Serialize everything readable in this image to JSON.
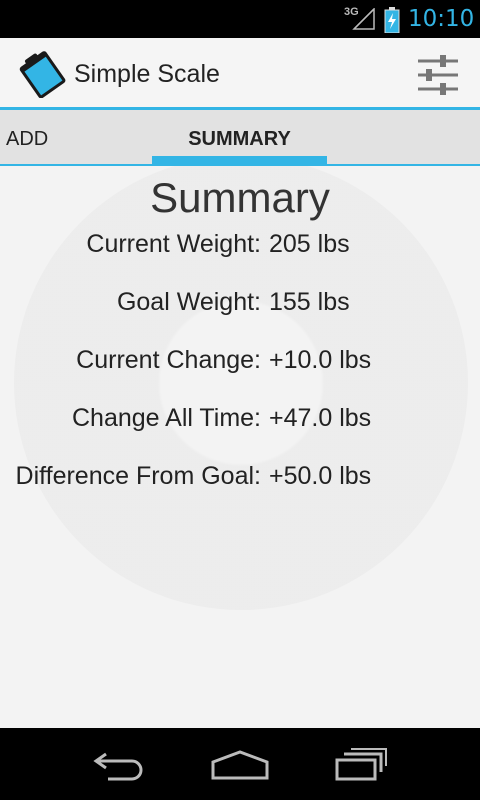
{
  "status_bar": {
    "network": "3G",
    "time": "10:10",
    "icons": [
      "signal-icon",
      "battery-charging-icon"
    ]
  },
  "action_bar": {
    "title": "Simple Scale",
    "icons": [
      "clipboard-icon",
      "sliders-icon"
    ]
  },
  "tabs": [
    {
      "label": "ADD",
      "selected": false
    },
    {
      "label": "SUMMARY",
      "selected": true
    }
  ],
  "summary": {
    "heading": "Summary",
    "rows": [
      {
        "label": "Current Weight:",
        "value": "205 lbs"
      },
      {
        "label": "Goal Weight:",
        "value": "155 lbs"
      },
      {
        "label": "Current Change:",
        "value": "+10.0 lbs"
      },
      {
        "label": "Change All Time:",
        "value": "+47.0 lbs"
      },
      {
        "label": "Difference From Goal:",
        "value": "+50.0 lbs"
      }
    ]
  },
  "nav_bar": {
    "icons": [
      "back-icon",
      "home-icon",
      "recents-icon"
    ]
  },
  "colors": {
    "accent": "#33b5e5",
    "background": "#f3f3f3"
  }
}
